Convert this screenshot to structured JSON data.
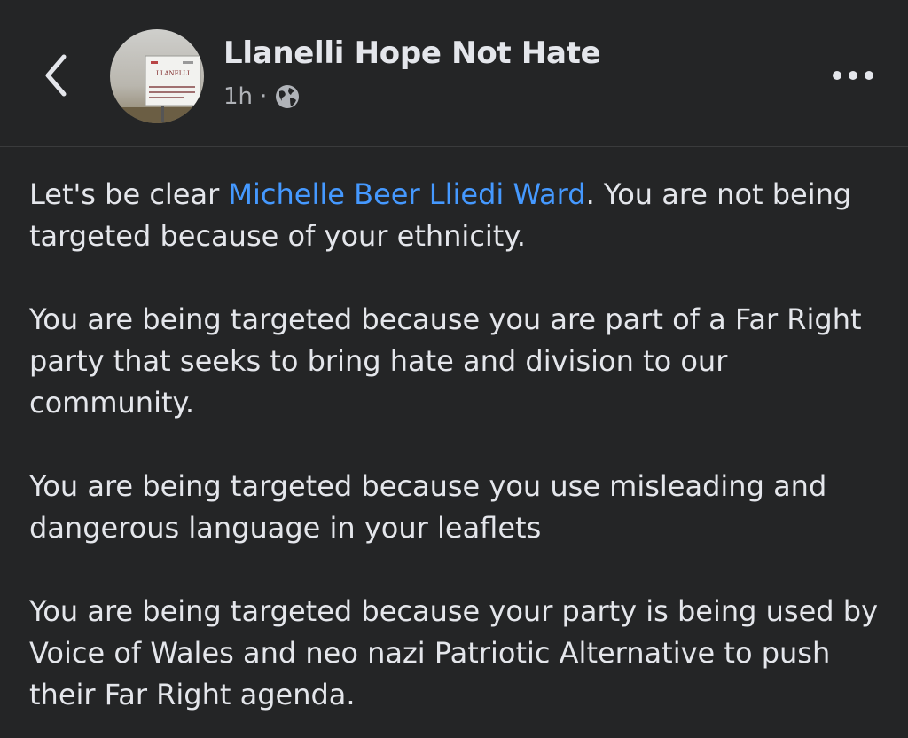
{
  "header": {
    "page_name": "Llanelli Hope Not Hate",
    "timestamp": "1h",
    "separator": "·",
    "privacy_icon": "globe-icon",
    "back_icon": "chevron-left-icon",
    "more_icon": "more-horizontal-icon",
    "avatar_sign_text": "LLANELLI"
  },
  "post": {
    "intro_before": "Let's be clear ",
    "mention": "Michelle Beer Lliedi Ward",
    "intro_after": ".  You are not being targeted because of your ethnicity.",
    "paragraph_2": "You are being targeted because you are part of a Far Right party that seeks to bring hate and division to our community.",
    "paragraph_3": "You are being targeted because you use misleading and dangerous language in your leaflets",
    "paragraph_4": "You are being targeted because your party is being used by Voice of Wales and neo nazi Patriotic Alternative to push their Far Right agenda."
  },
  "colors": {
    "background": "#242526",
    "text": "#e4e6eb",
    "secondary_text": "#b0b3b8",
    "link": "#4599ff",
    "divider": "#3a3b3c"
  }
}
